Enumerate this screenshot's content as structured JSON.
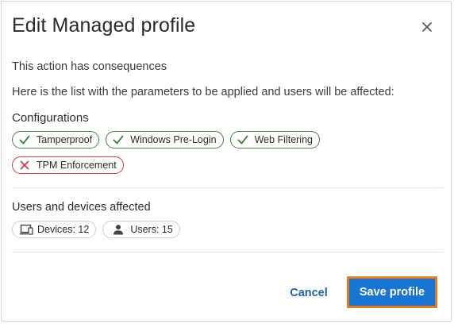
{
  "dialog": {
    "title": "Edit Managed profile",
    "close_icon": "close-icon"
  },
  "intro": {
    "line1": "This action has consequences",
    "line2": "Here is the list with the parameters to be applied and users will be affected:"
  },
  "configurations": {
    "title": "Configurations",
    "items": [
      {
        "label": "Tamperproof",
        "state": "enabled",
        "icon": "check-icon"
      },
      {
        "label": "Windows Pre-Login",
        "state": "enabled",
        "icon": "check-icon"
      },
      {
        "label": "Web Filtering",
        "state": "enabled",
        "icon": "check-icon"
      },
      {
        "label": "TPM Enforcement",
        "state": "disabled",
        "icon": "cross-icon"
      }
    ]
  },
  "affected": {
    "title": "Users and devices affected",
    "devices_label": "Devices: 12",
    "users_label": "Users: 15"
  },
  "footer": {
    "cancel_label": "Cancel",
    "save_label": "Save profile"
  },
  "colors": {
    "enabled": "#3b8a3b",
    "disabled": "#d03a3a",
    "primary": "#1875d1",
    "focus": "#e07b1f"
  }
}
